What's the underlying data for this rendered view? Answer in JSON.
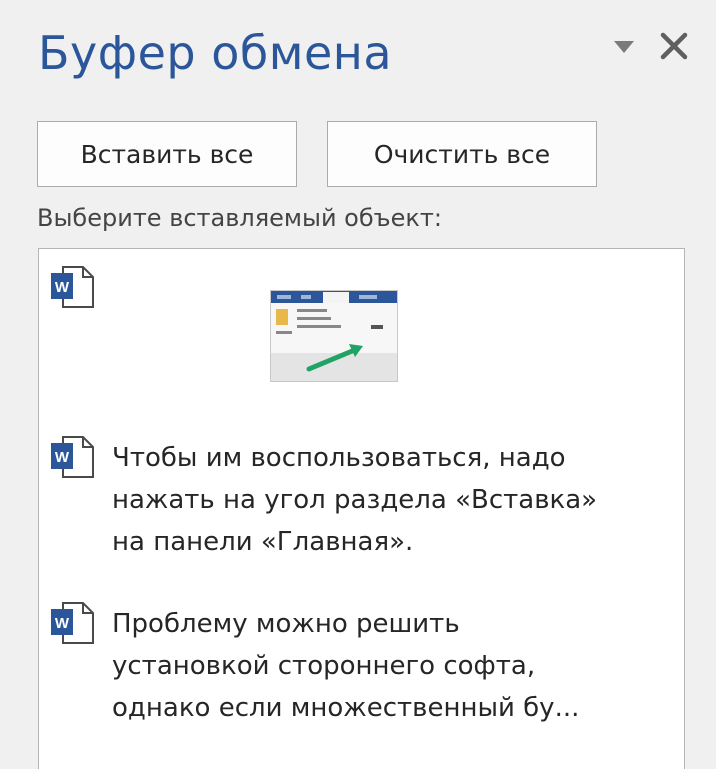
{
  "pane": {
    "title": "Буфер обмена"
  },
  "toolbar": {
    "paste_all_label": "Вставить все",
    "clear_all_label": "Очистить все"
  },
  "prompt": "Выберите вставляемый объект:",
  "items": [
    {
      "type": "image",
      "icon": "word-document-icon"
    },
    {
      "type": "text",
      "icon": "word-document-icon",
      "text": "Чтобы им воспользоваться, надо\nнажать на угол раздела «Вставка»\nна панели «Главная»."
    },
    {
      "type": "text",
      "icon": "word-document-icon",
      "text": "Проблему можно решить\nустановкой стороннего софта,\nоднако если множественный бу..."
    }
  ],
  "colors": {
    "title": "#2b579a",
    "word_blue": "#2b579a",
    "arrow_green": "#21a366"
  }
}
